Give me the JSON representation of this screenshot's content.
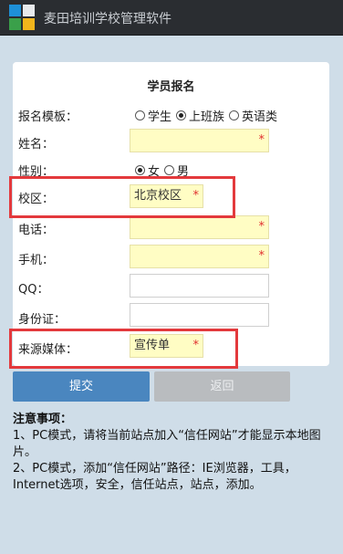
{
  "app": {
    "title": "麦田培训学校管理软件"
  },
  "form": {
    "title": "学员报名",
    "template": {
      "label": "报名模板：",
      "options": [
        "学生",
        "上班族",
        "英语类"
      ],
      "selected": "上班族"
    },
    "name": {
      "label": "姓名：",
      "value": "",
      "required_mark": "*"
    },
    "gender": {
      "label": "性别：",
      "options": [
        "女",
        "男"
      ],
      "selected": "女"
    },
    "campus": {
      "label": "校区：",
      "value": "北京校区",
      "required_mark": "*"
    },
    "phone": {
      "label": "电话：",
      "value": "",
      "required_mark": "*"
    },
    "mobile": {
      "label": "手机：",
      "value": "",
      "required_mark": "*"
    },
    "qq": {
      "label": "QQ：",
      "value": ""
    },
    "id_card": {
      "label": "身份证：",
      "value": ""
    },
    "source": {
      "label": "来源媒体：",
      "value": "宣传单",
      "required_mark": "*"
    }
  },
  "buttons": {
    "submit": "提交",
    "back": "返回"
  },
  "notes": {
    "heading": "注意事项：",
    "line1": "1、PC模式，请将当前站点加入“信任网站”才能显示本地图片。",
    "line2": "2、PC模式，添加“信任网站”路径：IE浏览器，工具，Internet选项，安全，信任站点，站点，添加。"
  },
  "colors": {
    "accent": "#4a86bf",
    "required_bg": "#fffdc4",
    "highlight": "#e3393c",
    "titlebar": "#2a2d31",
    "background": "#cfdde8"
  }
}
